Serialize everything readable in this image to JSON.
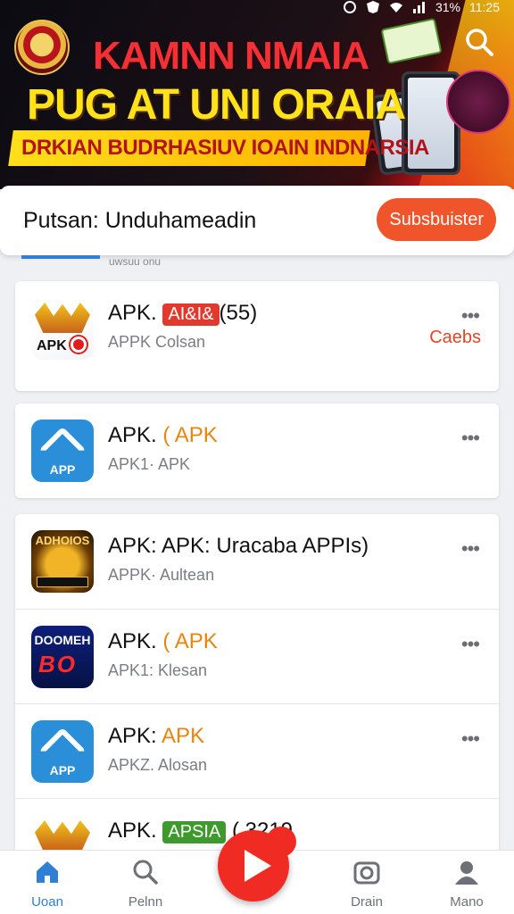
{
  "status_bar": {
    "battery": "31%",
    "time": "11:25"
  },
  "banner": {
    "title_line1": "KAMNN NMAIA",
    "title_line2": "PUG AT UNI ORAIA",
    "subtitle": "DRKIAN BUDRHASIUV IOAIN INDNARSIA"
  },
  "header": {
    "title": "Putsan: Unduhameadin",
    "subscribe_label": "Subsbuister",
    "peek_text": "uwsuu onu"
  },
  "apps": [
    {
      "name_prefix": "APK.",
      "tag": "AI&I&",
      "tag_color": "red",
      "name_suffix": "(55)",
      "subtitle": "APPK   Colsan",
      "aside": "Caebs",
      "more": "•••",
      "icon": "crown-icon"
    },
    {
      "name_prefix": "APK.",
      "name_accent": "( APK",
      "subtitle": "APK1·  APK",
      "more": "•••",
      "icon": "apk-icon",
      "icon_label": "APP"
    },
    {
      "name_prefix": "APK: APK: Uracaba APPIs)",
      "subtitle": "APPK·  Aultean",
      "more": "•••",
      "icon": "gold-icon",
      "icon_label": "ADHOIOS"
    },
    {
      "name_prefix": "APK.",
      "name_accent": "( APK",
      "subtitle": "APK1:  Klesan",
      "more": "•••",
      "icon": "domino-icon",
      "icon_label": "DOOMEH",
      "icon_big": "BO"
    },
    {
      "name_prefix": "APK:",
      "name_accent": "APK",
      "subtitle": "APKZ.  Alosan",
      "more": "•••",
      "icon": "apk-icon",
      "icon_label": "APP"
    },
    {
      "name_prefix": "APK.",
      "tag": "APSIA",
      "tag_color": "green",
      "name_suffix": "( 3219",
      "icon": "crown-icon"
    }
  ],
  "nav": {
    "home": "Uoan",
    "search": "Pelnn",
    "drain": "Drain",
    "menu": "Mano"
  },
  "colors": {
    "accent": "#2f7fd5",
    "subscribe": "#f0542b",
    "fab": "#ef2b24"
  }
}
